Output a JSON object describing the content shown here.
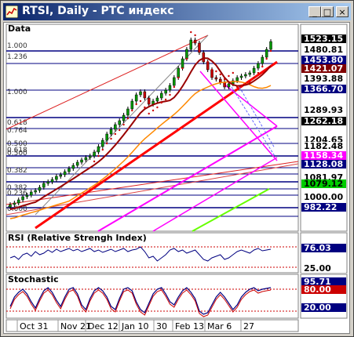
{
  "window": {
    "title": "RTSI, Daily - РТС индекс",
    "buttons": {
      "minimize": "_",
      "maximize": "□",
      "close": "×"
    }
  },
  "panels": {
    "price": {
      "label": "Data"
    },
    "rsi": {
      "label": "RSI (Relative Strengh Index)"
    },
    "stochastic": {
      "label": "Stochastic"
    }
  },
  "price_scale": {
    "levels": [
      "1523.15",
      "1480.81",
      "1453.80",
      "1421.07",
      "1393.88",
      "1366.70",
      "1289.93",
      "1262.18",
      "1204.65",
      "1182.48",
      "1158.34",
      "1128.08",
      "1081.97",
      "1079.12",
      "1000.00",
      "982.22"
    ],
    "colors": [
      "#000000",
      "#ffffff",
      "#000080",
      "#800000",
      "#ffffff",
      "#000080",
      "#ffffff",
      "#000000",
      "#ffffff",
      "#ffffff",
      "#ff00ff",
      "#000080",
      "#ffffff",
      "#00cc00",
      "#ffffff",
      "#000080"
    ]
  },
  "fib_labels": [
    "1.000",
    "1.236",
    "1.000",
    "0.500",
    "0.618",
    "0.764",
    "0.618",
    "0.500",
    "0.382",
    "0.382",
    "0.236",
    "0.000"
  ],
  "rsi_scale": {
    "levels": [
      "76.03",
      "25.00"
    ]
  },
  "stoch_scale": {
    "levels": [
      "95.71",
      "80.00",
      "20.00"
    ]
  },
  "time_axis": {
    "labels": [
      "Oct 31",
      "Nov 21",
      "Dec 12",
      "Jan 10",
      "30",
      "Feb 13",
      "Mar 6",
      "27"
    ]
  },
  "colors": {
    "titlebar_start": "#0a246a",
    "titlebar_end": "#a6caf0",
    "candle_up": "#009900",
    "candle_down": "#cc0000",
    "trend_red": "#ff0000",
    "ma_orange": "#ff8800",
    "ma_darkred": "#990000",
    "magenta": "#ff00ff",
    "lime": "#66ff00",
    "navy": "#000080"
  },
  "icons": [
    "app-chart-icon"
  ]
}
